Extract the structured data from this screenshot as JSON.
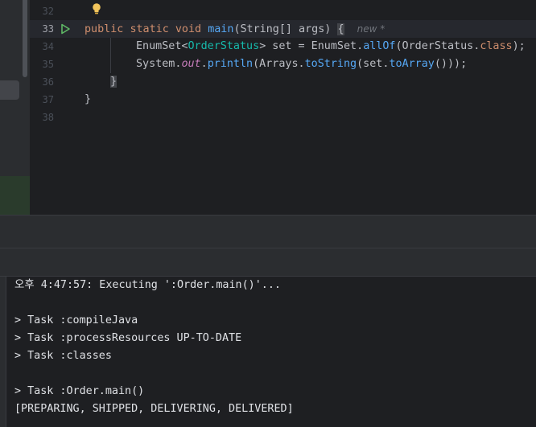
{
  "editor": {
    "line_numbers": [
      "32",
      "33",
      "34",
      "35",
      "36",
      "37",
      "38"
    ],
    "line33": {
      "kw_public": "public",
      "kw_static": "static",
      "kw_void": "void",
      "method": "main",
      "params_open": "(String[] args) ",
      "brace": "{",
      "hint": "new *"
    },
    "line34": {
      "type": "EnumSet",
      "lt": "<",
      "generic": "OrderStatus",
      "gt": ">",
      "var": " set = EnumSet.",
      "call": "allOf",
      "args_open": "(OrderStatus.",
      "kw_class": "class",
      "end": ");"
    },
    "line35": {
      "sys": "System.",
      "out": "out",
      "dot": ".",
      "println": "println",
      "open": "(Arrays.",
      "tostring": "toString",
      "mid": "(set.",
      "toarray": "toArray",
      "end": "()));"
    },
    "line36_brace": "}",
    "line37_brace": "}"
  },
  "console": {
    "lines": [
      "오후 4:47:57: Executing ':Order.main()'...",
      "",
      "> Task :compileJava",
      "> Task :processResources UP-TO-DATE",
      "> Task :classes",
      "",
      "> Task :Order.main()",
      "[PREPARING, SHIPPED, DELIVERING, DELIVERED]"
    ]
  },
  "colors": {
    "keyword": "#cf8e6d",
    "method": "#56a8f5",
    "static_field": "#c77dbb",
    "generic": "#16baac",
    "run_icon": "#5fb865",
    "bulb_icon": "#f2c55c"
  }
}
